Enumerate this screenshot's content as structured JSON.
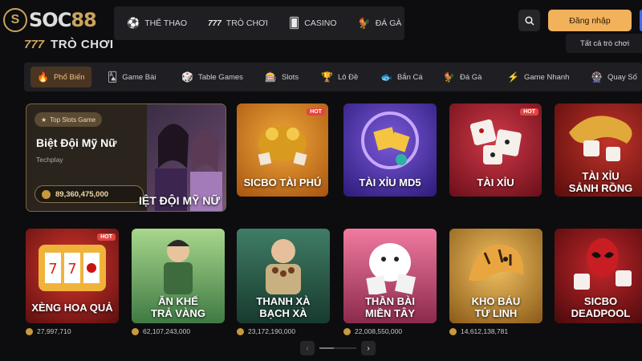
{
  "brand": {
    "logo_text": "SOC88"
  },
  "topnav": {
    "items": [
      {
        "label": "THỂ THAO",
        "icon": "soccer-ball-icon"
      },
      {
        "label": "TRÒ CHƠI",
        "icon": "777-icon"
      },
      {
        "label": "CASINO",
        "icon": "casino-chip-icon"
      },
      {
        "label": "ĐÁ GÀ",
        "icon": "rooster-icon"
      }
    ]
  },
  "header": {
    "login_label": "Đăng nhập",
    "search_icon": "search-icon"
  },
  "section": {
    "title": "TRÒ CHƠI",
    "all_label": "Tất cả trò chơi"
  },
  "tabs": [
    {
      "label": "Phổ Biến",
      "active": true
    },
    {
      "label": "Game Bài"
    },
    {
      "label": "Table Games"
    },
    {
      "label": "Slots"
    },
    {
      "label": "Lô Đề"
    },
    {
      "label": "Bắn Cá"
    },
    {
      "label": "Đá Gà"
    },
    {
      "label": "Game Nhanh"
    },
    {
      "label": "Quay Số"
    }
  ],
  "featured": {
    "badge": "Top Slots Game",
    "name": "Biệt Đội Mỹ Nữ",
    "provider": "Techplay",
    "jackpot": "89,360,475,000",
    "art_title": "IỆT ĐỘI MỸ NỮ"
  },
  "row1": [
    {
      "title": "SICBO TÀI PHÚ",
      "hot": "HOT",
      "color": "#c6711c"
    },
    {
      "title": "TÀI XỈU MD5",
      "color": "#4a2fa8"
    },
    {
      "title": "TÀI XỈU",
      "hot": "HOT",
      "color": "#a31f2e"
    },
    {
      "title": "TÀI XỈU SẢNH RỒNG",
      "line1": "TÀI XỈU",
      "line2": "SẢNH RỒNG",
      "color": "#8a1a1d"
    }
  ],
  "row2": [
    {
      "line1": "XÈNG HOA QUẢ",
      "line2": "",
      "hot": "HOT",
      "jackpot": "27,997,710",
      "color": "#9b2722"
    },
    {
      "line1": "ĂN KHẾ",
      "line2": "TRẢ VÀNG",
      "jackpot": "62,107,243,000",
      "color": "#4f8a55"
    },
    {
      "line1": "THANH XÀ",
      "line2": "BẠCH XÀ",
      "jackpot": "23,172,190,000",
      "color": "#2d5d4c"
    },
    {
      "line1": "THẦN BÀI",
      "line2": "MIỀN TÂY",
      "jackpot": "22,008,550,000",
      "color": "#b34a6c"
    },
    {
      "line1": "KHO BÁU",
      "line2": "TỨ LINH",
      "jackpot": "14,612,138,781",
      "color": "#b98633"
    },
    {
      "line1": "SICBO",
      "line2": "DEADPOOL",
      "jackpot": "",
      "color": "#7d1a1a"
    }
  ],
  "pager": {
    "prev": "‹",
    "next": "›",
    "progress": 0.4
  }
}
